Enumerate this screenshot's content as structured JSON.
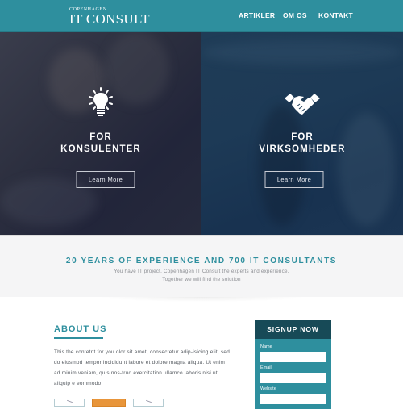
{
  "header": {
    "logo_small": "COPENHAGEN",
    "logo_big": "IT CONSULT",
    "nav": [
      "ARTIKLER",
      "OM OS",
      "KONTAKT"
    ]
  },
  "hero": {
    "panels": [
      {
        "icon": "lightbulb-icon",
        "title_line1": "FOR",
        "title_line2": "KONSULENTER",
        "button": "Learn More"
      },
      {
        "icon": "handshake-icon",
        "title_line1": "FOR",
        "title_line2": "VIRKSOMHEDER",
        "button": "Learn More"
      }
    ]
  },
  "tagline": {
    "heading": "20 YEARS OF EXPERIENCE AND 700 IT CONSULTANTS",
    "line1": "You have IT project. Copenhagen IT Consult the experts and experience.",
    "line2": "Together we will find the solution"
  },
  "about": {
    "heading": "ABOUT US",
    "text": "This the contetnt for  you olor sit amet, consectetur adip-isicing elit, sed do eiusmod tempor incididunt labore et dolore magna aliqua. Ut enim ad minim veniam, quis nos-trud exercitation ullamco laboris nisi ut aliquip e eommodo"
  },
  "signup": {
    "heading": "SIGNUP NOW",
    "fields": [
      {
        "label": "Name",
        "value": ""
      },
      {
        "label": "Email",
        "value": ""
      },
      {
        "label": "Website",
        "value": ""
      }
    ]
  },
  "colors": {
    "brand_teal": "#2e8f9e",
    "signup_header": "#174a57",
    "accent_orange": "#e8953a"
  }
}
